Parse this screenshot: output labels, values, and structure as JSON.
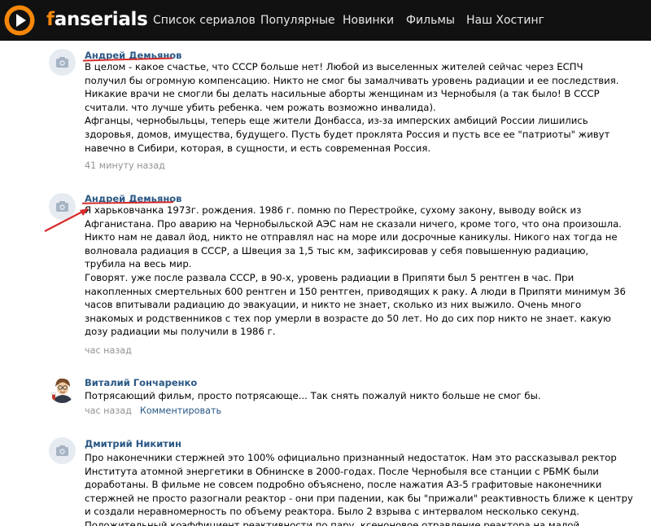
{
  "site": {
    "logo_prefix": "f",
    "logo_rest": "anserials",
    "nav": [
      "Список сериалов",
      "Популярные",
      "Новинки",
      "Фильмы",
      "Наш Хостинг"
    ],
    "colors": {
      "header_bg": "#111111",
      "accent": "#f5870a",
      "link": "#2a5885",
      "annotation": "#d62b2b"
    }
  },
  "comments": [
    {
      "author": "Андрей Демьянов",
      "avatar": "camera-icon",
      "lines": [
        "В целом - какое счастье, что СССР больше нет! Любой из выселенных жителей сейчас через ЕСПЧ",
        "получил бы огромную компенсацию. Никто не смог бы замалчивать уровень радиации и ее последствия.",
        "Никакие врачи не смогли бы делать насильные аборты женщинам из Чернобыля (а так было! В СССР",
        "считали. что лучше убить ребенка. чем рожать возможно инвалида).",
        "Афганцы, чернобыльцы, теперь еще жители Донбасса, из-за имперских амбиций России лишились",
        "здоровья, домов, имущества, будущего. Пусть будет проклята Россия и пусть все ее \"патриоты\" живут",
        "навечно в Сибири, которая, в сущности, и есть современная Россия."
      ],
      "time": "41 минуту назад"
    },
    {
      "author": "Андрей Демьянов",
      "avatar": "camera-icon",
      "lines": [
        "Я харьковчанка 1973г. рождения. 1986 г. помню по Перестройке, сухому закону, выводу войск из",
        "Афганистана. Про аварию на Чернобыльской АЭС нам не сказали ничего, кроме того, что она произошла.",
        "Никто нам не давал йод, никто не отправлял нас на море или досрочные каникулы. Никого нах тогда не",
        "волновала радиация в СССР, а Швеция за 1,5 тыс км, зафиксировав у себя повышенную радиацию,",
        "трубила на весь мир.",
        "Говорят. уже после развала СССР, в 90-х, уровень радиации в Припяти был 5 рентген в час. При",
        "накопленных смертельных 600 рентген и 150 рентген, приводящих к раку. А люди в Припяти минимум 36",
        "часов впитывали радиацию до эвакуации, и никто не знает, сколько из них выжило. Очень много",
        "знакомых и родственников с тех пор умерли в возрасте до 50 лет. Но до сих пор никто не знает. какую",
        "дозу радиации мы получили в 1986 г."
      ],
      "time": "час назад"
    },
    {
      "author": "Виталий Гончаренко",
      "avatar": "user-photo",
      "lines": [
        "Потрясающий фильм, просто потрясающе... Так снять пожалуй никто больше не смог бы."
      ],
      "time": "час назад",
      "reply": "Комментировать"
    },
    {
      "author": "Дмитрий Никитин",
      "avatar": "camera-icon",
      "lines": [
        "Про наконечники стержней это 100% официально признанный недостаток. Нам это рассказывал ректор",
        "Института атомной энергетики в Обнинске в 2000-годах. После Чернобыля все станции с РБМК были",
        "доработаны. В фильме не совсем подробно объяснено, после нажатия АЗ-5 графитовые наконечники",
        "стержней не просто разогнали реактор - они при падении, как бы \"прижали\" реактивность ближе к центру",
        "и создали неравномерность по объему реактора. Было 2 взрыва с интервалом несколько секунд.",
        "Положительный коэффициент реактивности по пару, ксеноновое отравление реактора на малой"
      ]
    }
  ]
}
